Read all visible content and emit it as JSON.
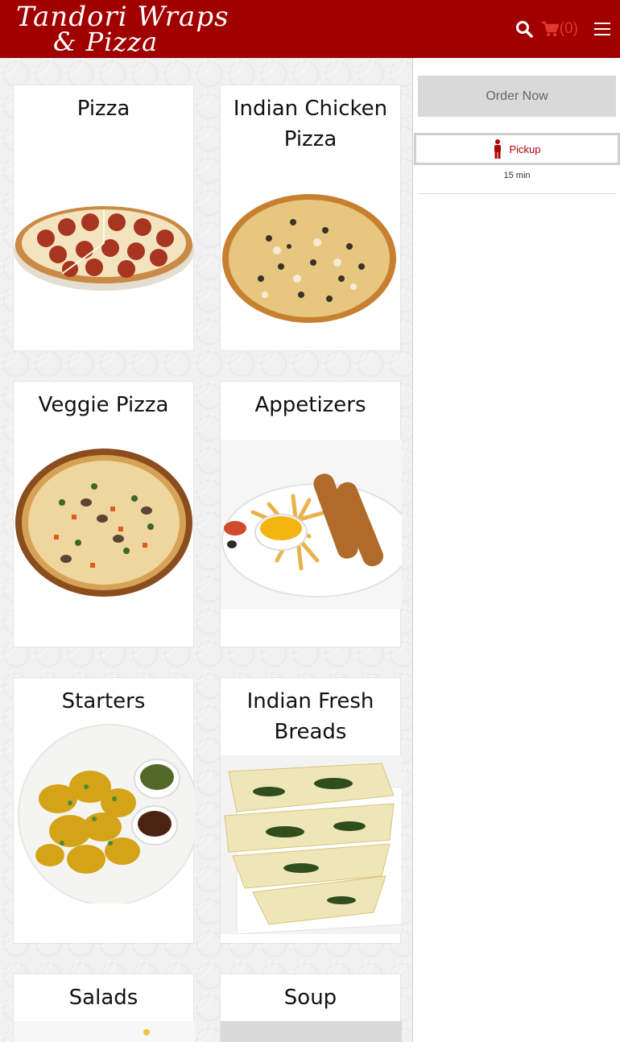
{
  "header": {
    "logo_line1": "Tandori Wraps",
    "logo_line2": "& Pizza",
    "cart_count": "(0)",
    "colors": {
      "bar": "#a00000",
      "cart": "#e3372f"
    },
    "icons": [
      "search-icon",
      "cart-icon",
      "hamburger-menu-icon"
    ]
  },
  "categories": [
    {
      "title": "Pizza",
      "image": "pepperoni-pizza"
    },
    {
      "title": "Indian Chicken Pizza",
      "image": "chicken-pizza"
    },
    {
      "title": "Veggie Pizza",
      "image": "veggie-pizza"
    },
    {
      "title": "Appetizers",
      "image": "chicken-strips-fries"
    },
    {
      "title": "Starters",
      "image": "pakora-plate"
    },
    {
      "title": "Indian Fresh Breads",
      "image": "naan-bread"
    },
    {
      "title": "Salads",
      "image": "salad"
    },
    {
      "title": "Soup",
      "image": "soup"
    }
  ],
  "order_panel": {
    "order_button": "Order Now",
    "pickup_label": "Pickup",
    "eta": "15 min",
    "colors": {
      "button_bg": "#d9d9d9",
      "pickup_text": "#b00000"
    }
  }
}
